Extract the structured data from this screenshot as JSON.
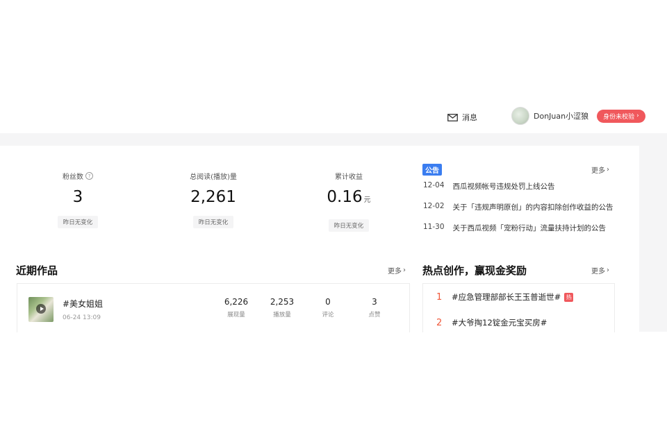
{
  "header": {
    "messages_label": "消息",
    "username": "DonJuan小涩狼",
    "verify_button": "身份未校验"
  },
  "stats": [
    {
      "label": "粉丝数",
      "value": "3",
      "unit": "",
      "change": "昨日无变化",
      "has_help_icon": true
    },
    {
      "label": "总阅读(播放)量",
      "value": "2,261",
      "unit": "",
      "change": "昨日无变化",
      "has_help_icon": false
    },
    {
      "label": "累计收益",
      "value": "0.16",
      "unit": "元",
      "change": "昨日无变化",
      "has_help_icon": false
    }
  ],
  "notices": {
    "tag": "公告",
    "more": "更多",
    "items": [
      {
        "date": "12-04",
        "title": "西瓜视频帐号违规处罚上线公告"
      },
      {
        "date": "12-02",
        "title": "关于「违规声明原创」的内容扣除创作收益的公告"
      },
      {
        "date": "11-30",
        "title": "关于西瓜视频「宠粉行动」流量扶持计划的公告"
      }
    ]
  },
  "recent_works": {
    "title": "近期作品",
    "more": "更多",
    "items": [
      {
        "title": "#美女姐姐",
        "time": "06-24 13:09",
        "metrics": [
          {
            "value": "6,226",
            "label": "展现量"
          },
          {
            "value": "2,253",
            "label": "播放量"
          },
          {
            "value": "0",
            "label": "评论"
          },
          {
            "value": "3",
            "label": "点赞"
          }
        ]
      }
    ]
  },
  "hot_topics": {
    "title": "热点创作，赢现金奖励",
    "more": "更多",
    "items": [
      {
        "rank": "1",
        "title": "#应急管理部部长王玉普逝世#",
        "badge": "热"
      },
      {
        "rank": "2",
        "title": "#大爷掏12锭金元宝买房#",
        "badge": ""
      }
    ]
  },
  "colors": {
    "accent_red": "#f0585c",
    "notice_blue": "#3a7df0",
    "rank_orange": "#f0583a"
  }
}
